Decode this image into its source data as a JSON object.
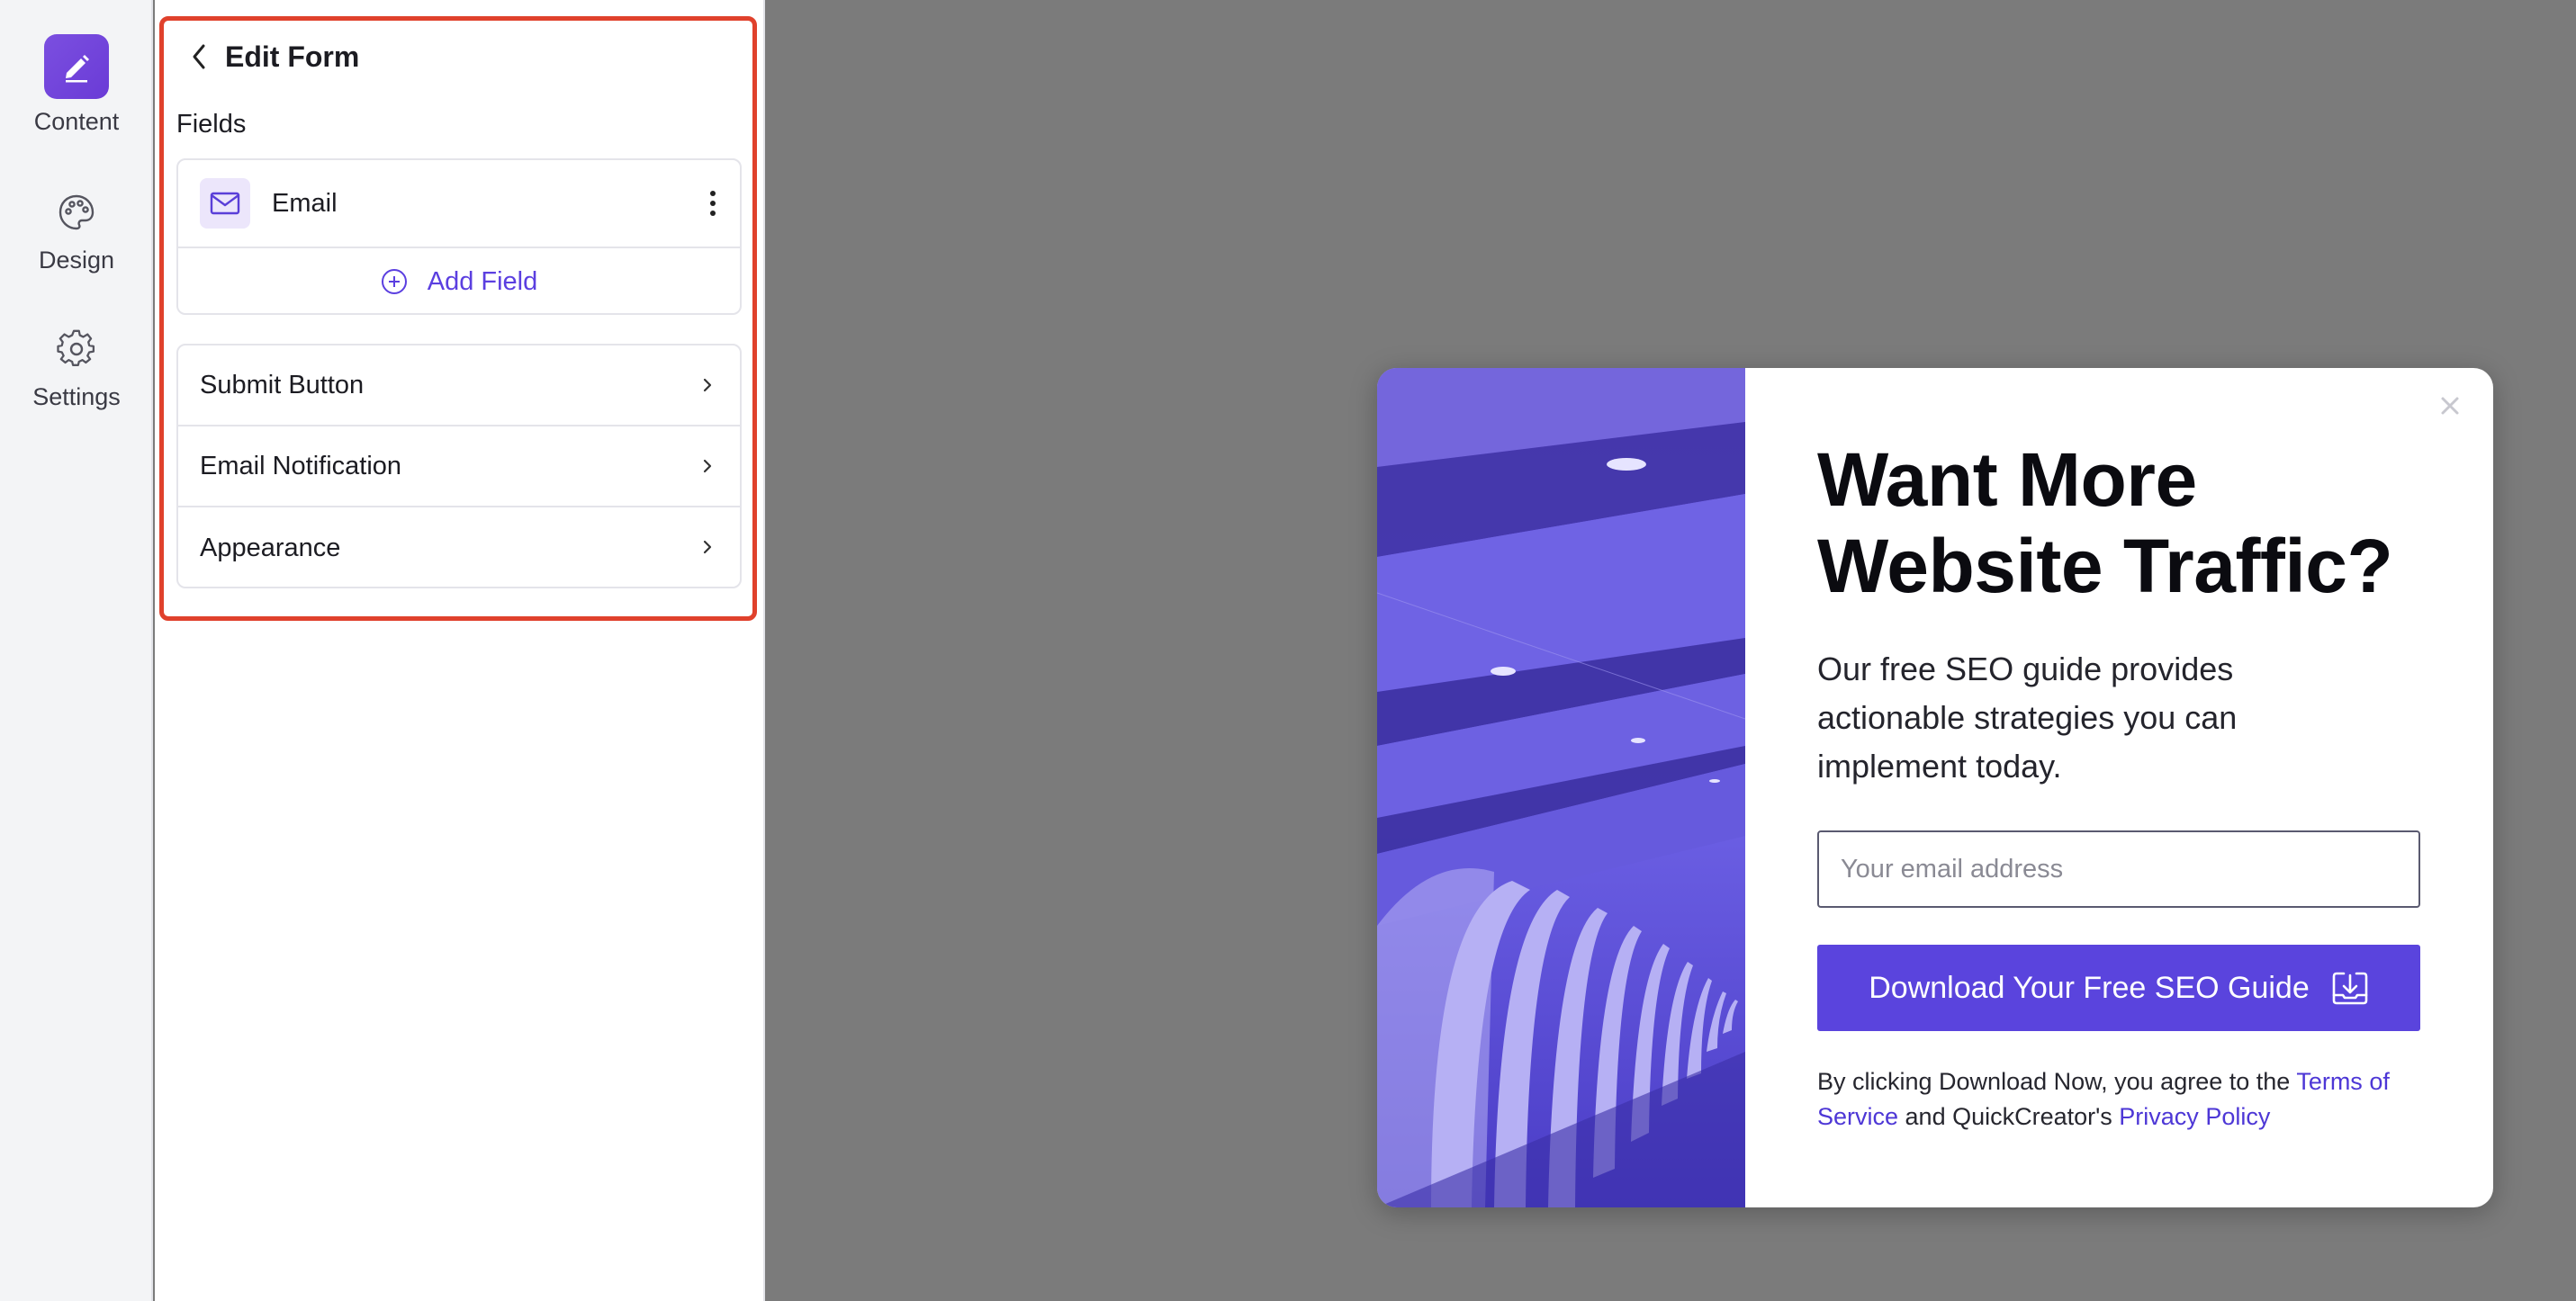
{
  "rail": {
    "items": [
      {
        "label": "Content",
        "icon": "pencil-icon",
        "active": true
      },
      {
        "label": "Design",
        "icon": "palette-icon",
        "active": false
      },
      {
        "label": "Settings",
        "icon": "gear-icon",
        "active": false
      }
    ]
  },
  "panel": {
    "title": "Edit Form",
    "fields_label": "Fields",
    "fields": [
      {
        "name": "Email",
        "icon": "envelope-icon"
      }
    ],
    "add_field_label": "Add Field",
    "settings_rows": [
      {
        "label": "Submit Button"
      },
      {
        "label": "Email Notification"
      },
      {
        "label": "Appearance"
      }
    ],
    "highlight_color": "#e0412c"
  },
  "popup": {
    "headline": "Want More Website Traffic?",
    "subtext": "Our free SEO guide provides actionable strategies you can implement today.",
    "email_placeholder": "Your email address",
    "cta_label": "Download Your Free SEO Guide",
    "legal": {
      "prefix": "By clicking Download Now, you agree to the ",
      "terms_link": "Terms of Service",
      "middle": " and QuickCreator's ",
      "privacy_link": "Privacy Policy"
    },
    "accent_color": "#5a44dd"
  }
}
